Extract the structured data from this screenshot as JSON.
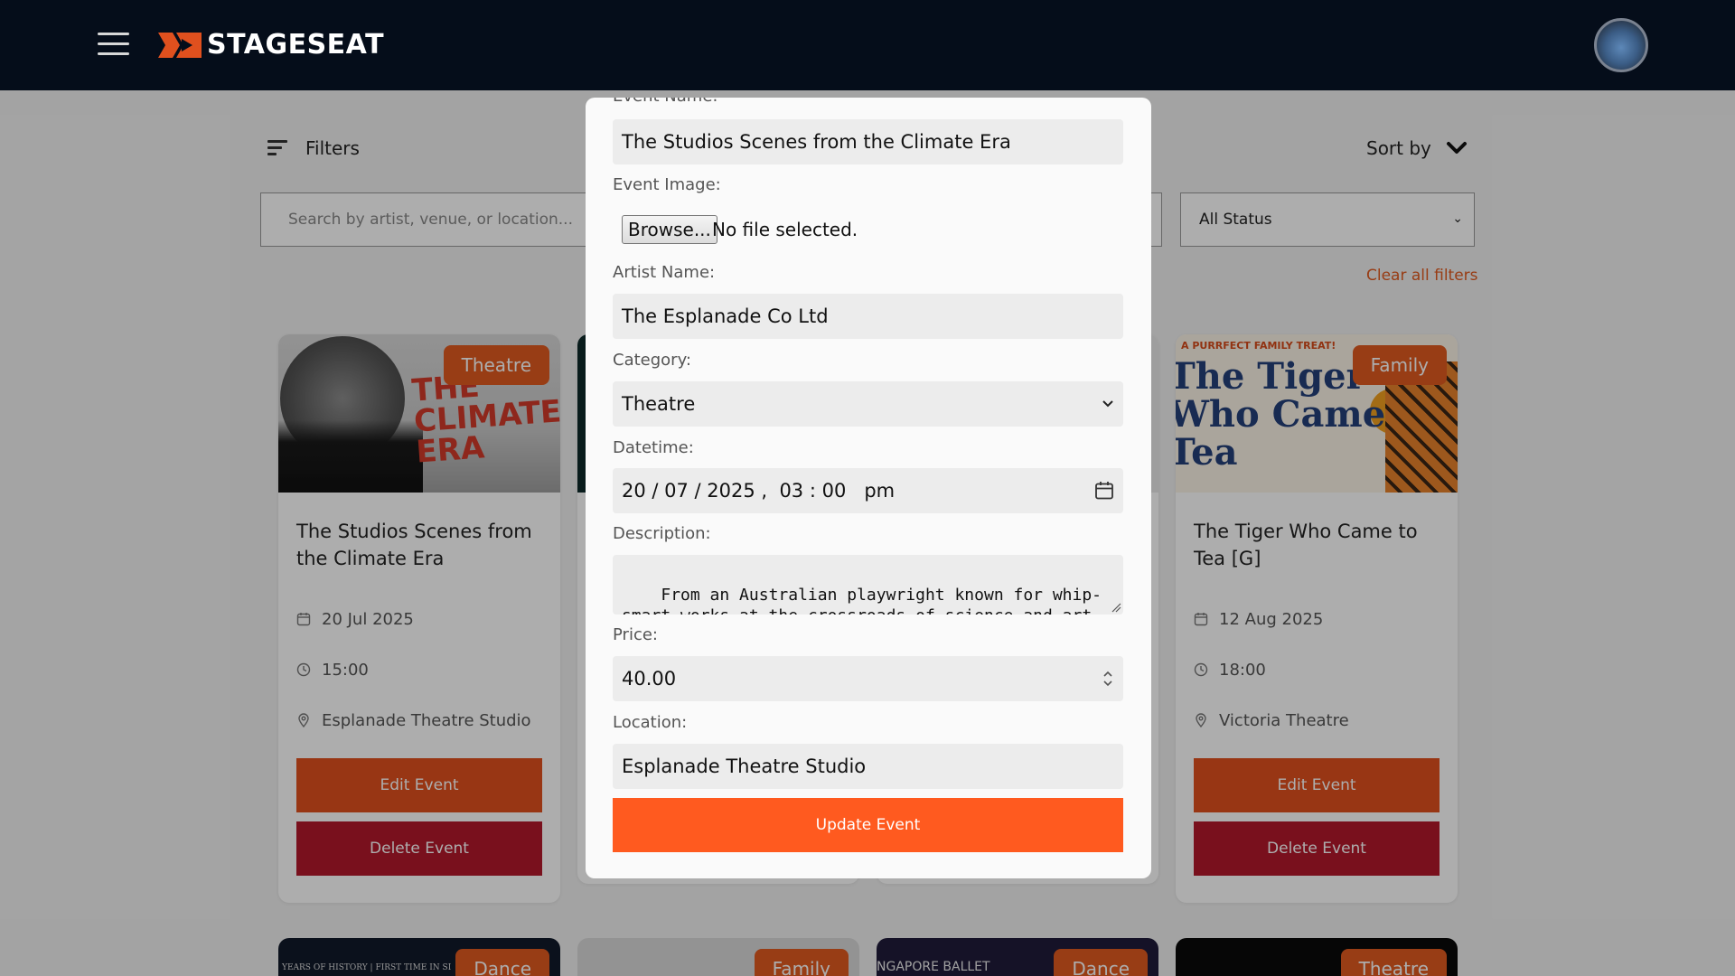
{
  "header": {
    "brand": "STAGESEAT",
    "menu_icon": "hamburger-icon",
    "avatar_icon": "user-avatar"
  },
  "toolbar": {
    "filters_label": "Filters",
    "sort_label": "Sort by",
    "search_placeholder": "Search by artist, venue, or location...",
    "status_value": "All Status",
    "clear_filters": "Clear all filters"
  },
  "cards": [
    {
      "badge": "Theatre",
      "title": "The Studios Scenes from the Climate Era",
      "date": "20 Jul 2025",
      "time": "15:00",
      "venue": "Esplanade Theatre Studio",
      "edit_label": "Edit Event",
      "delete_label": "Delete Event",
      "image_text": "THE CLIMATE ERA"
    },
    {
      "badge": "Family",
      "title": "The Tiger Who Came to Tea [G]",
      "date": "12 Aug 2025",
      "time": "18:00",
      "venue": "Victoria Theatre",
      "edit_label": "Edit Event",
      "delete_label": "Delete Event",
      "image_tag": "A PURRFECT FAMILY TREAT!",
      "image_title": "The Tiger Who Came to Tea"
    }
  ],
  "bottom_row": [
    {
      "badge": "Dance",
      "image_text": "YEARS OF HISTORY | FIRST TIME IN SI"
    },
    {
      "badge": "Family"
    },
    {
      "badge": "Dance",
      "image_text": "NGAPORE BALLET"
    },
    {
      "badge": "Theatre"
    }
  ],
  "modal": {
    "event_name_label": "Event Name:",
    "event_name_value": "The Studios Scenes from the Climate Era",
    "event_image_label": "Event Image:",
    "browse_label": "Browse...",
    "no_file": "No file selected.",
    "artist_label": "Artist Name:",
    "artist_value": "The Esplanade Co Ltd",
    "category_label": "Category:",
    "category_value": "Theatre",
    "datetime_label": "Datetime:",
    "datetime_value": "20 / 07 / 2025 ,  03 : 00   pm",
    "description_label": "Description:",
    "description_value": "From an Australian playwright known for whip-smart works at the crossroads of science and art, comes a dazzling and provocative reflection on",
    "price_label": "Price:",
    "price_value": "40.00",
    "location_label": "Location:",
    "location_value": "Esplanade Theatre Studio",
    "update_label": "Update Event"
  },
  "colors": {
    "header_bg": "#050d1a",
    "accent": "#ff5a1f",
    "edit": "#e0501e",
    "delete": "#b3182b"
  }
}
